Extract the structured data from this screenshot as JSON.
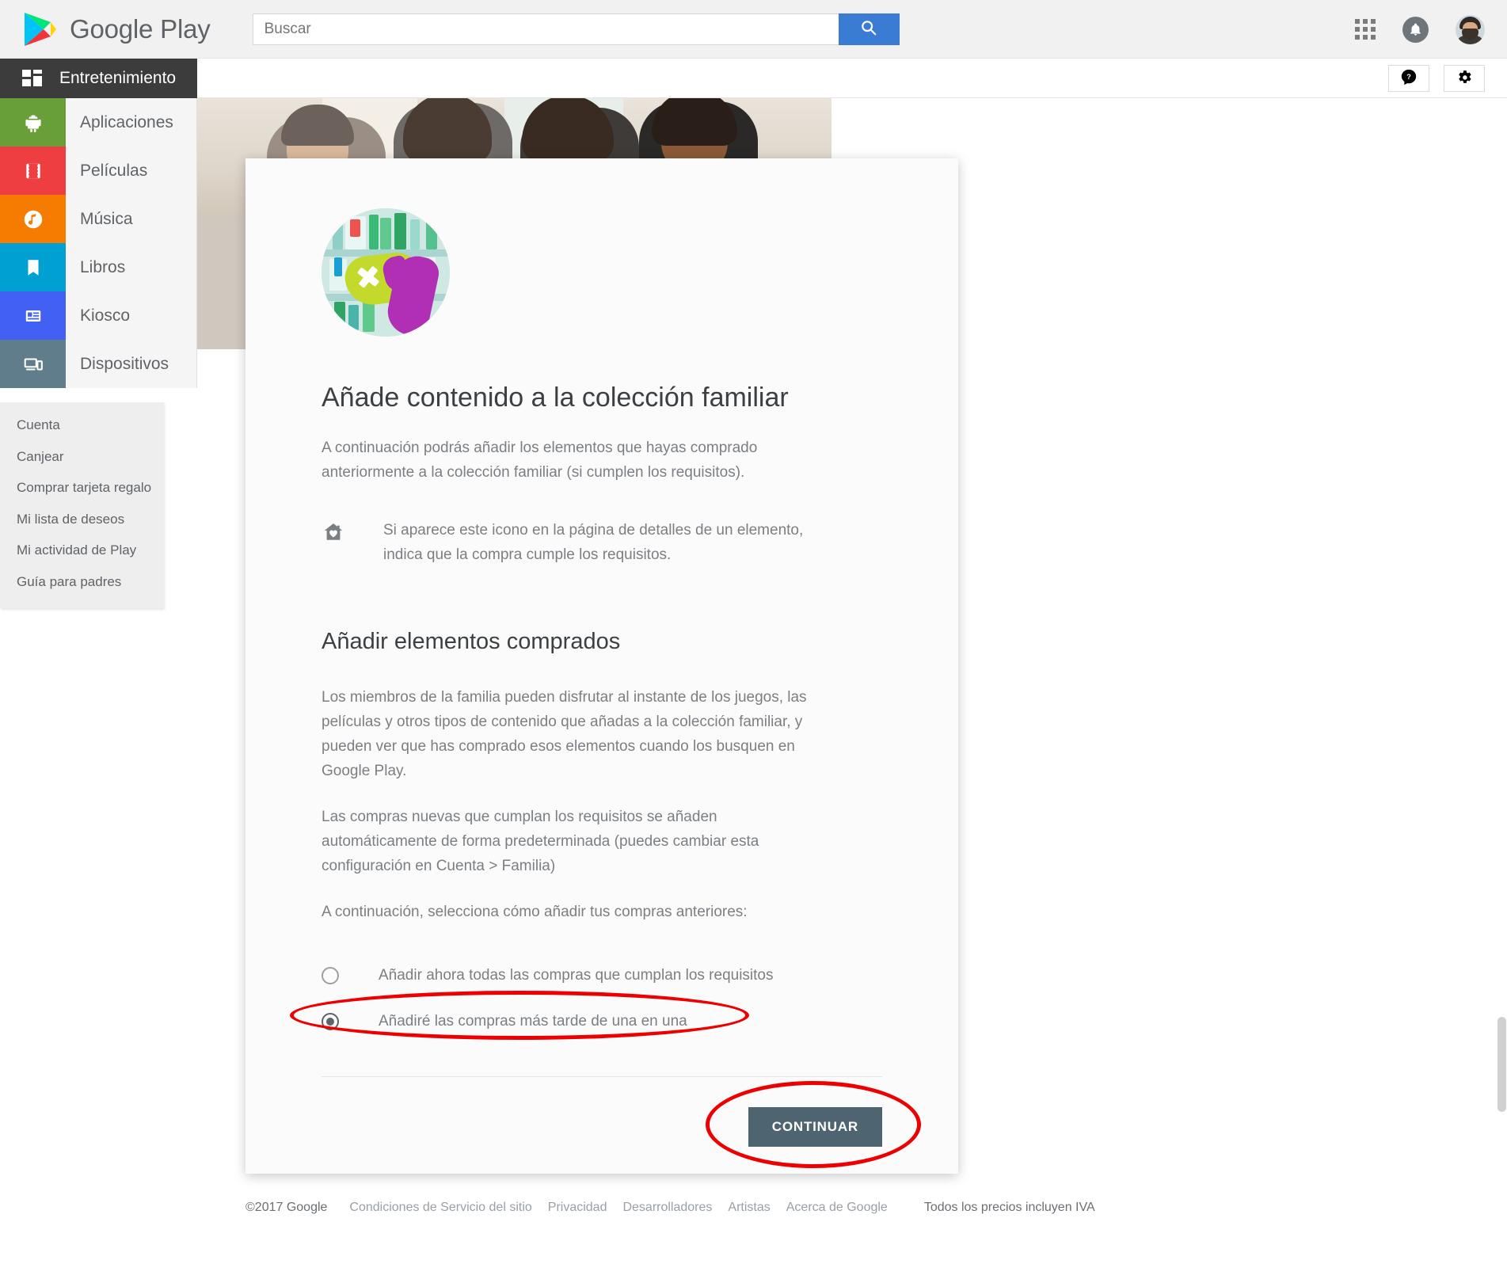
{
  "header": {
    "brand": "Google Play",
    "search_placeholder": "Buscar",
    "search_value": "",
    "search_button_icon": "search-icon",
    "apps_icon": "apps-grid-icon",
    "notifications_icon": "bell-icon",
    "avatar_icon": "user-avatar"
  },
  "subheader": {
    "help_icon": "help-icon",
    "settings_icon": "gear-icon"
  },
  "sidebar": {
    "current_section": "Entretenimiento",
    "items": [
      {
        "label": "Aplicaciones",
        "icon": "android-icon",
        "color": "#689f38"
      },
      {
        "label": "Películas",
        "icon": "film-icon",
        "color": "#ef3e42"
      },
      {
        "label": "Música",
        "icon": "music-note-icon",
        "color": "#f57c00"
      },
      {
        "label": "Libros",
        "icon": "book-icon",
        "color": "#00a0d2"
      },
      {
        "label": "Kiosco",
        "icon": "newsstand-icon",
        "color": "#4360f5"
      },
      {
        "label": "Dispositivos",
        "icon": "devices-icon",
        "color": "#607d8b"
      }
    ],
    "sub_items": [
      "Cuenta",
      "Canjear",
      "Comprar tarjeta regalo",
      "Mi lista de deseos",
      "Mi actividad de Play",
      "Guía para padres"
    ]
  },
  "modal": {
    "illustration_icon": "family-library-illustration",
    "title": "Añade contenido a la colección familiar",
    "intro": "A continuación podrás añadir los elementos que hayas comprado anteriormente a la colección familiar (si cumplen los requisitos).",
    "note_icon": "family-house-heart-icon",
    "note_text": "Si aparece este icono en la página de detalles de un elemento, indica que la compra cumple los requisitos.",
    "section_title": "Añadir elementos comprados",
    "paragraph_1": "Los miembros de la familia pueden disfrutar al instante de los juegos, las películas y otros tipos de contenido que añadas a la colección familiar, y pueden ver que has comprado esos elementos cuando los busquen en Google Play.",
    "paragraph_2": "Las compras nuevas que cumplan los requisitos se añaden automáticamente de forma predeterminada (puedes cambiar esta configuración en Cuenta > Familia)",
    "paragraph_3": "A continuación, selecciona cómo añadir tus compras anteriores:",
    "options": [
      {
        "label": "Añadir ahora todas las compras que cumplan los requisitos",
        "selected": false
      },
      {
        "label": "Añadiré las compras más tarde de una en una",
        "selected": true
      }
    ],
    "continue_label": "CONTINUAR"
  },
  "annotations": {
    "color": "#ee0000",
    "targets": [
      "selected-radio-option",
      "continue-button"
    ]
  },
  "footer": {
    "copyright": "©2017 Google",
    "links": [
      "Condiciones de Servicio del sitio",
      "Privacidad",
      "Desarrolladores",
      "Artistas",
      "Acerca de Google"
    ],
    "tax_note": "Todos los precios incluyen IVA"
  }
}
